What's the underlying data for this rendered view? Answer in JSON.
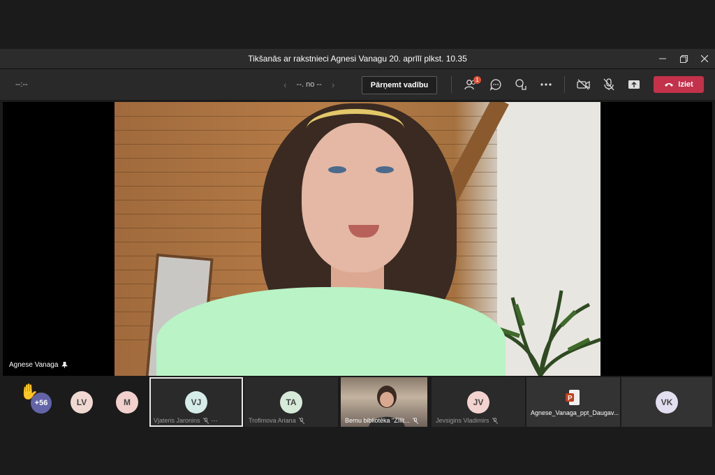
{
  "window": {
    "title": "Tikšanās ar rakstnieci Agnesi Vanagu 20. aprīlī plkst. 10.35"
  },
  "toolbar": {
    "timer": "--:--",
    "pager_label": "--. no --",
    "takeover_label": "Pārņemt vadību",
    "participants_badge": "1",
    "leave_label": "Iziet"
  },
  "stage": {
    "speaker_name": "Agnese Vanaga"
  },
  "roster": {
    "overflow_count": "+56",
    "tiles": [
      {
        "initials": "LV",
        "color": "#f0d9d2"
      },
      {
        "initials": "M",
        "color": "#f2d0cd"
      },
      {
        "initials": "VJ",
        "name": "Vjateris Jaronins",
        "color": "#d6ece9"
      },
      {
        "initials": "TA",
        "name": "Trofimova Ariana",
        "color": "#d7ead9"
      },
      {
        "name": "Bernu bibliotēka \"Zīlīt..."
      },
      {
        "initials": "JV",
        "name": "Jevsigins Vladimirs",
        "color": "#f3d3d0"
      },
      {
        "name": "Agnese_Vanaga_ppt_Daugav..."
      },
      {
        "initials": "VK",
        "color": "#e3dff0"
      }
    ]
  }
}
